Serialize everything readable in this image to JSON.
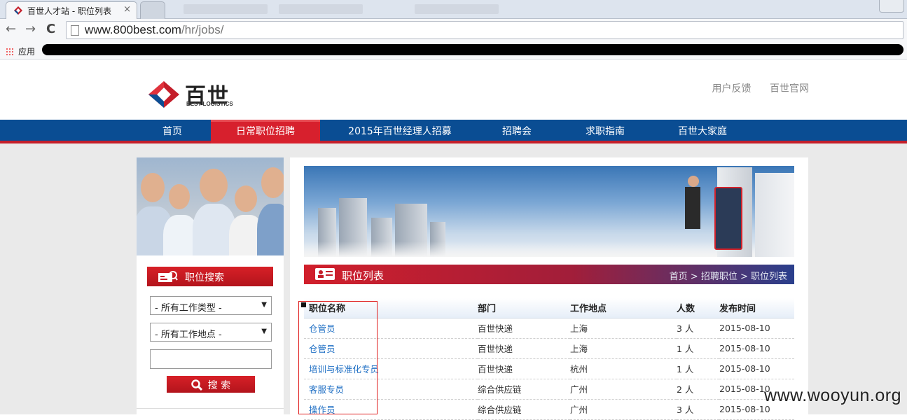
{
  "browser": {
    "active_tab_title": "百世人才站 - 职位列表",
    "tab_close": "×",
    "url_host": "www.800best.com",
    "url_path": "/hr/jobs/",
    "bookmarks_apps": "应用",
    "back": "←",
    "forward": "→",
    "reload": "C"
  },
  "header": {
    "logo_cn": "百世",
    "logo_en": "BEST LOGISTICS",
    "link_feedback": "用户反馈",
    "link_official": "百世官网"
  },
  "nav": {
    "items": [
      "首页",
      "日常职位招聘",
      "2015年百世经理人招募",
      "招聘会",
      "求职指南",
      "百世大家庭"
    ],
    "active_index": 1
  },
  "sidebar": {
    "search_title": "职位搜索",
    "job_type_select": "- 所有工作类型 -",
    "location_select": "- 所有工作地点 -",
    "keyword_value": "",
    "search_button": "搜 索"
  },
  "main": {
    "section_title": "职位列表",
    "breadcrumb": "首页 > 招聘职位 > 职位列表",
    "columns": [
      "职位名称",
      "部门",
      "工作地点",
      "人数",
      "发布时间"
    ],
    "rows": [
      {
        "title": "仓管员",
        "dept": "百世快递",
        "loc": "上海",
        "count": "3 人",
        "date": "2015-08-10"
      },
      {
        "title": "仓管员",
        "dept": "百世快递",
        "loc": "上海",
        "count": "1 人",
        "date": "2015-08-10"
      },
      {
        "title": "培训与标准化专员",
        "dept": "百世快递",
        "loc": "杭州",
        "count": "1 人",
        "date": "2015-08-10"
      },
      {
        "title": "客服专员",
        "dept": "综合供应链",
        "loc": "广州",
        "count": "2 人",
        "date": "2015-08-10"
      },
      {
        "title": "操作员",
        "dept": "综合供应链",
        "loc": "广州",
        "count": "3 人",
        "date": "2015-08-10"
      }
    ]
  },
  "watermark": "www.wooyun.org",
  "colors": {
    "nav_blue": "#0a4d93",
    "brand_red": "#d7202d",
    "link_blue": "#1f6fc4"
  }
}
